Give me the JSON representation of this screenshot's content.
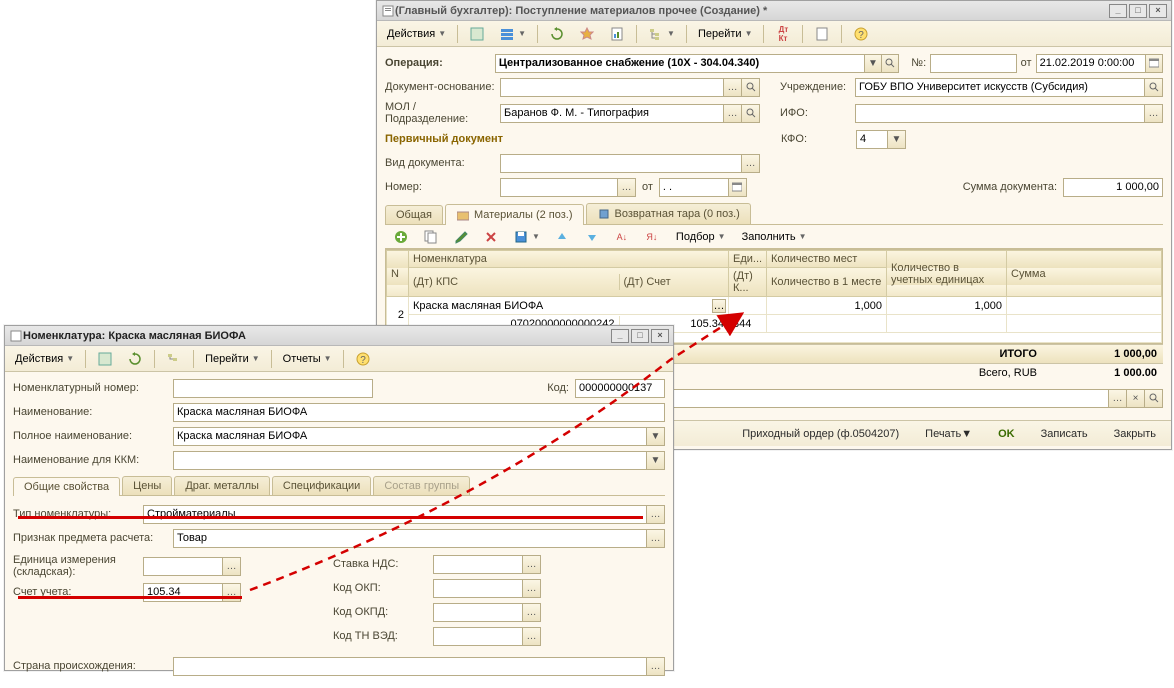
{
  "mainWindow": {
    "title": "(Главный бухгалтер): Поступление материалов прочее (Создание) *",
    "toolbar": {
      "actions": "Действия",
      "goto": "Перейти"
    },
    "form": {
      "operation_label": "Операция:",
      "operation_value": "Централизованное снабжение (10X - 304.04.340)",
      "no_label": "№:",
      "no_value": "",
      "ot_label": "от",
      "date_value": "21.02.2019 0:00:00",
      "docbase_label": "Документ-основание:",
      "docbase_value": "",
      "org_label": "Учреждение:",
      "org_value": "ГОБУ ВПО Университет искусств (Субсидия)",
      "mol_label": "МОЛ / Подразделение:",
      "mol_value": "Баранов Ф. М. - Типография",
      "ifo_label": "ИФО:",
      "ifo_value": "",
      "primary_doc_label": "Первичный документ",
      "kfo_label": "КФО:",
      "kfo_value": "4",
      "doc_type_label": "Вид документа:",
      "doc_type_value": "",
      "number_label": "Номер:",
      "number_value": "",
      "number_ot": "от",
      "number_date": ". .",
      "sum_label": "Сумма документа:",
      "sum_value": "1 000,00"
    },
    "tabs": {
      "general": "Общая",
      "materials": "Материалы (2 поз.)",
      "tare": "Возвратная тара (0 поз.)"
    },
    "gridToolbar": {
      "select": "Подбор",
      "fill": "Заполнить"
    },
    "gridHeader": {
      "n": "N",
      "item": "Номенклатура",
      "unit": "Еди...",
      "qty_places": "Количество мест",
      "qty_units": "Количество в учетных единицах",
      "sum": "Сумма",
      "kps": "(Дт) КПС",
      "acct": "(Дт) Счет",
      "k": "(Дт) К...",
      "qty_per": "Количество в 1 месте"
    },
    "gridRow": {
      "n": "2",
      "item": "Краска масляная БИОФА",
      "qty_places": "1,000",
      "qty_units": "1,000",
      "kps": "07020000000000242",
      "acct": "105.34",
      "k": "344"
    },
    "totals": {
      "itogo_label": "ИТОГО",
      "itogo_value": "1 000,00",
      "vsego_label": "Всего, RUB",
      "vsego_value": "1 000.00"
    },
    "bottom": {
      "order": "Приходный ордер (ф.0504207)",
      "print": "Печать",
      "ok": "OK",
      "save": "Записать",
      "close": "Закрыть"
    }
  },
  "nomWindow": {
    "title": "Номенклатура: Краска масляная БИОФА",
    "toolbar": {
      "actions": "Действия",
      "goto": "Перейти",
      "reports": "Отчеты"
    },
    "form": {
      "nom_num_label": "Номенклатурный номер:",
      "nom_num_value": "",
      "code_label": "Код:",
      "code_value": "000000000137",
      "name_label": "Наименование:",
      "name_value": "Краска масляная БИОФА",
      "fullname_label": "Полное наименование:",
      "fullname_value": "Краска масляная БИОФА",
      "kkm_label": "Наименование для ККМ:",
      "kkm_value": ""
    },
    "tabs": {
      "general": "Общие свойства",
      "prices": "Цены",
      "metals": "Драг. металлы",
      "specs": "Спецификации",
      "group": "Состав группы"
    },
    "props": {
      "type_label": "Тип номенклатуры:",
      "type_value": "Стройматериалы",
      "calc_label": "Признак предмета расчета:",
      "calc_value": "Товар",
      "unit_label": "Единица измерения (складская):",
      "unit_value": "",
      "acct_label": "Счет учета:",
      "acct_value": "105.34",
      "vat_label": "Ставка НДС:",
      "okp_label": "Код ОКП:",
      "okpd_label": "Код ОКПД:",
      "tnved_label": "Код ТН ВЭД:",
      "origin_label": "Страна происхождения:",
      "origin_value": ""
    }
  }
}
